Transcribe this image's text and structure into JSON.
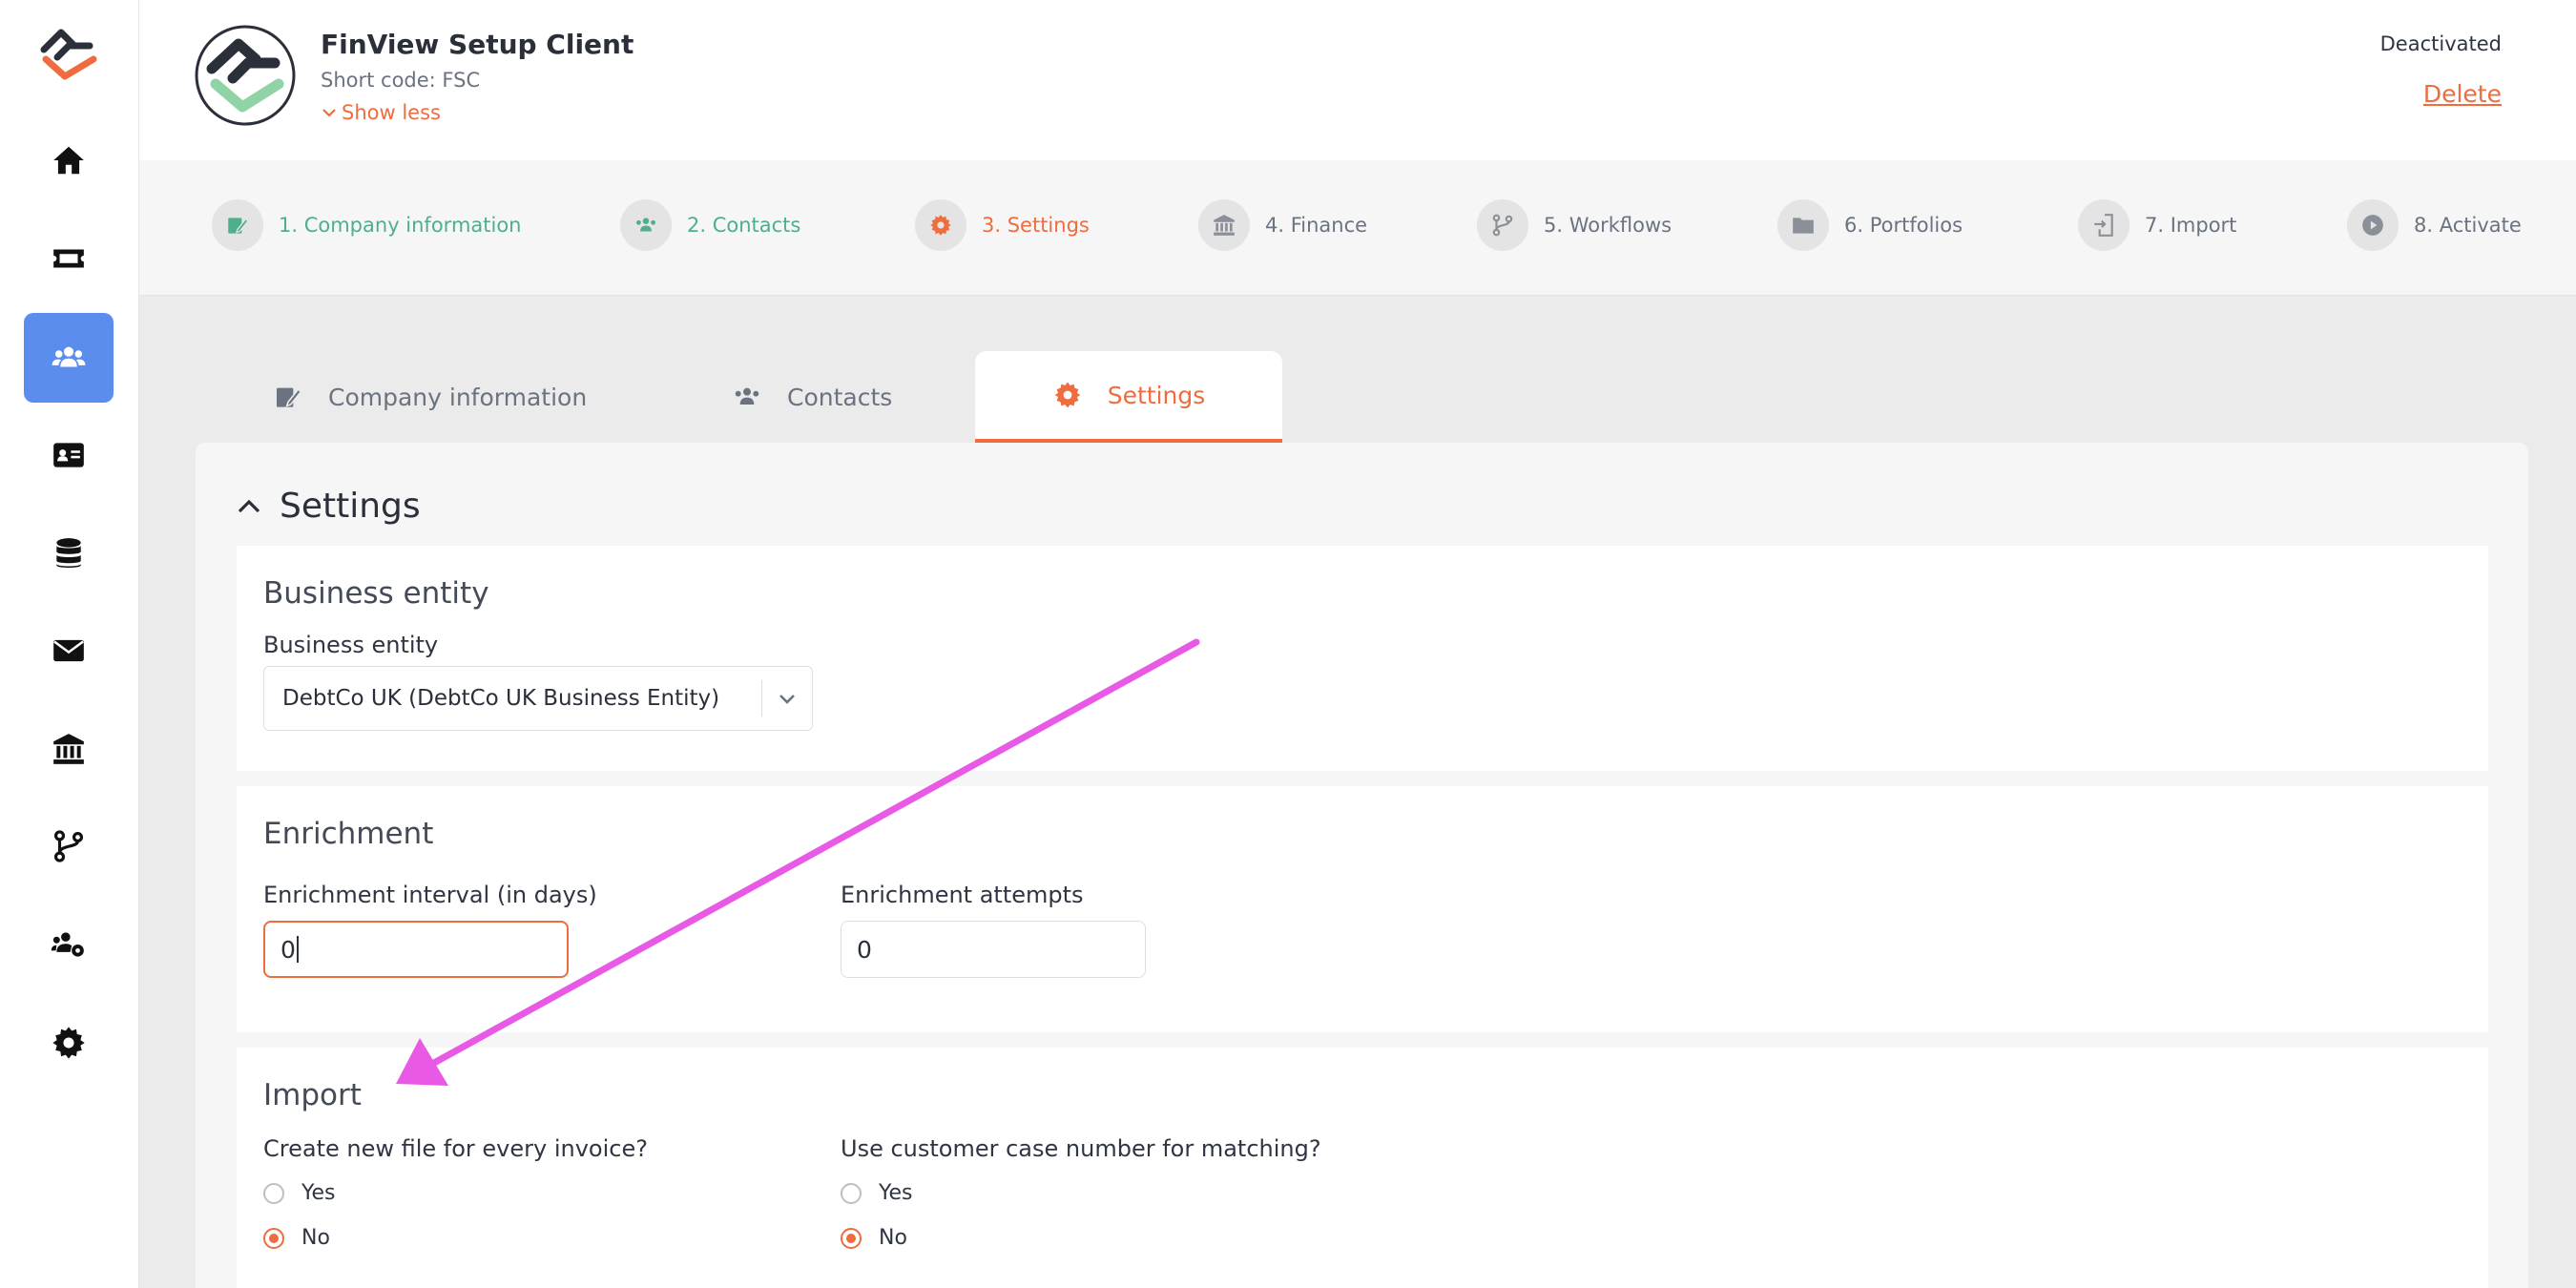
{
  "header": {
    "client_name": "FinView Setup Client",
    "short_code": "Short code: FSC",
    "show_less": "Show less",
    "status": "Deactivated",
    "delete": "Delete"
  },
  "steps": [
    {
      "label": "1. Company information",
      "state": "done",
      "icon": "company-edit-icon"
    },
    {
      "label": "2. Contacts",
      "state": "done",
      "icon": "contacts-icon"
    },
    {
      "label": "3. Settings",
      "state": "current",
      "icon": "gear-icon"
    },
    {
      "label": "4. Finance",
      "state": "pending",
      "icon": "bank-icon"
    },
    {
      "label": "5. Workflows",
      "state": "pending",
      "icon": "branch-icon"
    },
    {
      "label": "6. Portfolios",
      "state": "pending",
      "icon": "folder-icon"
    },
    {
      "label": "7. Import",
      "state": "pending",
      "icon": "import-icon"
    },
    {
      "label": "8. Activate",
      "state": "pending",
      "icon": "play-icon"
    }
  ],
  "tabs": [
    {
      "label": "Company information",
      "icon": "company-edit-icon"
    },
    {
      "label": "Contacts",
      "icon": "contacts-icon"
    },
    {
      "label": "Settings",
      "icon": "gear-icon",
      "active": true
    }
  ],
  "settings": {
    "title": "Settings",
    "business_entity": {
      "title": "Business entity",
      "field_label": "Business entity",
      "value": "DebtCo UK (DebtCo UK Business Entity)"
    },
    "enrichment": {
      "title": "Enrichment",
      "interval_label": "Enrichment interval (in days)",
      "interval_value": "0",
      "attempts_label": "Enrichment attempts",
      "attempts_value": "0"
    },
    "import": {
      "title": "Import",
      "new_file_label": "Create new file for every invoice?",
      "case_number_label": "Use customer case number for matching?",
      "yes": "Yes",
      "no": "No"
    }
  },
  "colors": {
    "accent": "#ef6c3f",
    "done": "#4fae8b",
    "nav_active": "#5b8def",
    "annotation_arrow": "#e85ae6"
  }
}
